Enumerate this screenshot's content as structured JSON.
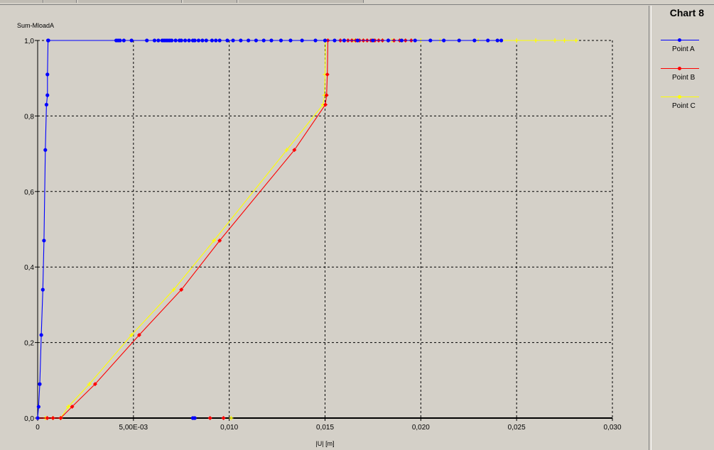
{
  "legend": {
    "title": "Chart 8"
  },
  "chart_data": {
    "type": "line",
    "title": "Chart 8",
    "xlabel": "|U| [m]",
    "ylabel": "Sum-MloadA",
    "xlim": [
      0,
      0.03
    ],
    "ylim": [
      0,
      1.0
    ],
    "x_ticks": [
      {
        "value": 0,
        "label": "0"
      },
      {
        "value": 0.005,
        "label": "5,00E-03"
      },
      {
        "value": 0.01,
        "label": "0,010"
      },
      {
        "value": 0.015,
        "label": "0,015"
      },
      {
        "value": 0.02,
        "label": "0,020"
      },
      {
        "value": 0.025,
        "label": "0,025"
      },
      {
        "value": 0.03,
        "label": "0,030"
      }
    ],
    "y_ticks": [
      {
        "value": 0,
        "label": "0,0"
      },
      {
        "value": 0.2,
        "label": "0,2"
      },
      {
        "value": 0.4,
        "label": "0,4"
      },
      {
        "value": 0.6,
        "label": "0,6"
      },
      {
        "value": 0.8,
        "label": "0,8"
      },
      {
        "value": 1.0,
        "label": "1,0"
      }
    ],
    "grid": true,
    "legend_position": "right",
    "series": [
      {
        "name": "Point A",
        "color": "#0000ff",
        "marker": "circle",
        "x": [
          0,
          5e-05,
          0.00011,
          0.00019,
          0.00027,
          0.00033,
          0.0004,
          0.00046,
          0.00051,
          0.00051,
          0.00054,
          0.00056,
          0.0041,
          0.0042,
          0.0043,
          0.0045,
          0.0049,
          0.0057,
          0.0061,
          0.0063,
          0.0065,
          0.0066,
          0.0067,
          0.0068,
          0.0069,
          0.007,
          0.0072,
          0.0074,
          0.0075,
          0.0077,
          0.0079,
          0.0081,
          0.0082,
          0.0084,
          0.0086,
          0.0088,
          0.0091,
          0.0093,
          0.0095,
          0.0099,
          0.0102,
          0.0106,
          0.011,
          0.0114,
          0.0118,
          0.0122,
          0.0127,
          0.0132,
          0.0138,
          0.0145,
          0.015,
          0.0155,
          0.016,
          0.0167,
          0.0175,
          0.0183,
          0.019,
          0.0197,
          0.0205,
          0.0212,
          0.022,
          0.0228,
          0.0235,
          0.024,
          0.0242
        ],
        "y": [
          0,
          0.03,
          0.09,
          0.22,
          0.34,
          0.47,
          0.71,
          0.83,
          0.855,
          0.91,
          1.0,
          1.0,
          1.0,
          1.0,
          1.0,
          1.0,
          1.0,
          1.0,
          1.0,
          1.0,
          1.0,
          1.0,
          1.0,
          1.0,
          1.0,
          1.0,
          1.0,
          1.0,
          1.0,
          1.0,
          1.0,
          1.0,
          1.0,
          1.0,
          1.0,
          1.0,
          1.0,
          1.0,
          1.0,
          1.0,
          1.0,
          1.0,
          1.0,
          1.0,
          1.0,
          1.0,
          1.0,
          1.0,
          1.0,
          1.0,
          1.0,
          1.0,
          1.0,
          1.0,
          1.0,
          1.0,
          1.0,
          1.0,
          1.0,
          1.0,
          1.0,
          1.0,
          1.0,
          1.0,
          1.0
        ]
      },
      {
        "name": "Point B",
        "color": "#ff0000",
        "marker": "diamond",
        "x": [
          0,
          0.0005,
          0.0008,
          0.0012,
          0.0018,
          0.003,
          0.0053,
          0.0075,
          0.0095,
          0.0134,
          0.01502,
          0.01508,
          0.01512,
          0.01515,
          0.0158,
          0.016,
          0.0162,
          0.0164,
          0.0166,
          0.0168,
          0.017,
          0.0172,
          0.0174,
          0.0176,
          0.0178,
          0.018,
          0.0183,
          0.0186,
          0.0189,
          0.0192,
          0.0195
        ],
        "y": [
          0,
          0,
          0,
          0,
          0.03,
          0.09,
          0.22,
          0.34,
          0.47,
          0.71,
          0.83,
          0.855,
          0.91,
          1.0,
          1.0,
          1.0,
          1.0,
          1.0,
          1.0,
          1.0,
          1.0,
          1.0,
          1.0,
          1.0,
          1.0,
          1.0,
          1.0,
          1.0,
          1.0,
          1.0,
          1.0
        ]
      },
      {
        "name": "Point C",
        "color": "#ffff00",
        "marker": "cross",
        "x": [
          0,
          0.0004,
          0.0008,
          0.0012,
          0.0016,
          0.0027,
          0.0049,
          0.0071,
          0.0092,
          0.013,
          0.0149,
          0.01497,
          0.015,
          0.01503,
          0.0165,
          0.017,
          0.0175,
          0.018,
          0.0185,
          0.019,
          0.02,
          0.021,
          0.022,
          0.023,
          0.024,
          0.025,
          0.026,
          0.027,
          0.0275,
          0.0281
        ],
        "y": [
          0,
          0,
          0,
          0,
          0.03,
          0.09,
          0.22,
          0.34,
          0.47,
          0.71,
          0.83,
          0.855,
          0.91,
          1.0,
          1.0,
          1.0,
          1.0,
          1.0,
          1.0,
          1.0,
          1.0,
          1.0,
          1.0,
          1.0,
          1.0,
          1.0,
          1.0,
          1.0,
          1.0,
          1.0
        ]
      }
    ]
  }
}
